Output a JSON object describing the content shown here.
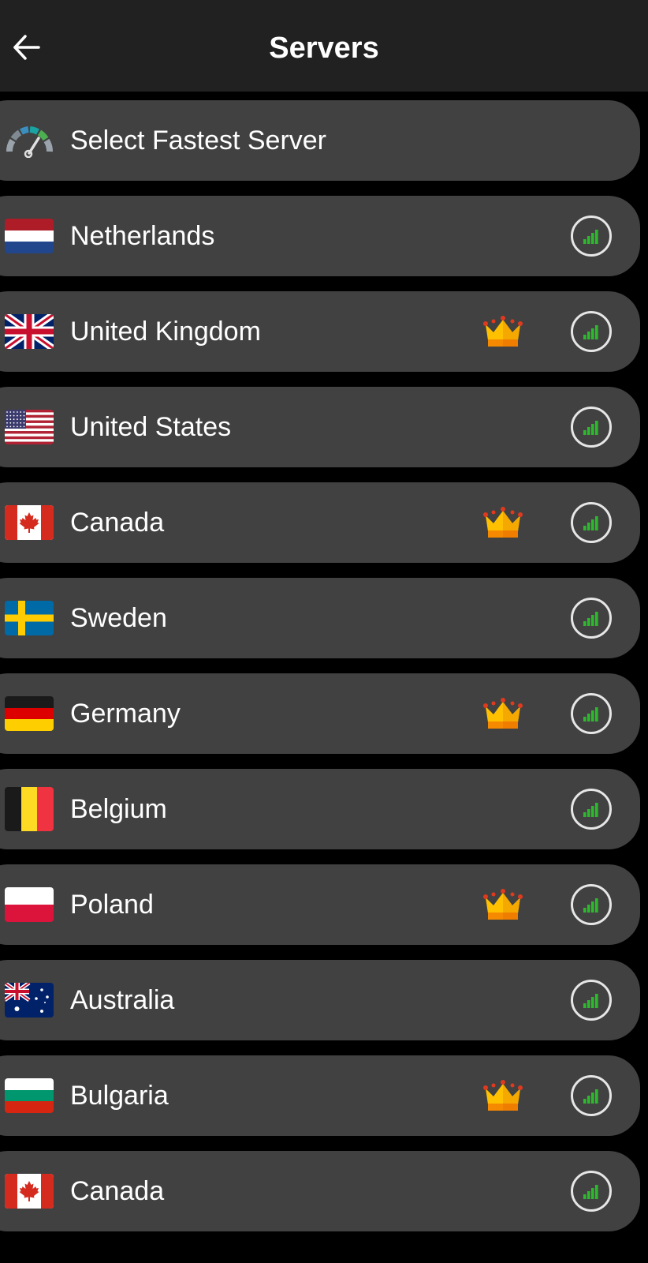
{
  "header": {
    "title": "Servers",
    "back_icon": "arrow-left-icon"
  },
  "fastest": {
    "label": "Select Fastest Server",
    "icon": "speedometer-icon"
  },
  "servers": [
    {
      "name": "Netherlands",
      "flag": "nl",
      "premium": false,
      "signal_icon": "signal-strength-icon"
    },
    {
      "name": "United Kingdom",
      "flag": "uk",
      "premium": true,
      "signal_icon": "signal-strength-icon"
    },
    {
      "name": "United States",
      "flag": "us",
      "premium": false,
      "signal_icon": "signal-strength-icon"
    },
    {
      "name": "Canada",
      "flag": "ca",
      "premium": true,
      "signal_icon": "signal-strength-icon"
    },
    {
      "name": "Sweden",
      "flag": "se",
      "premium": false,
      "signal_icon": "signal-strength-icon"
    },
    {
      "name": "Germany",
      "flag": "de",
      "premium": true,
      "signal_icon": "signal-strength-icon"
    },
    {
      "name": "Belgium",
      "flag": "be",
      "premium": false,
      "signal_icon": "signal-strength-icon"
    },
    {
      "name": "Poland",
      "flag": "pl",
      "premium": true,
      "signal_icon": "signal-strength-icon"
    },
    {
      "name": "Australia",
      "flag": "au",
      "premium": false,
      "signal_icon": "signal-strength-icon"
    },
    {
      "name": "Bulgaria",
      "flag": "bg",
      "premium": true,
      "signal_icon": "signal-strength-icon"
    },
    {
      "name": "Canada",
      "flag": "ca",
      "premium": false,
      "signal_icon": "signal-strength-icon"
    }
  ],
  "colors": {
    "background": "#000000",
    "header": "#212121",
    "row": "#414141",
    "text": "#ffffff",
    "signal_green": "#2eb82e",
    "crown_gold": "#ffc000"
  }
}
